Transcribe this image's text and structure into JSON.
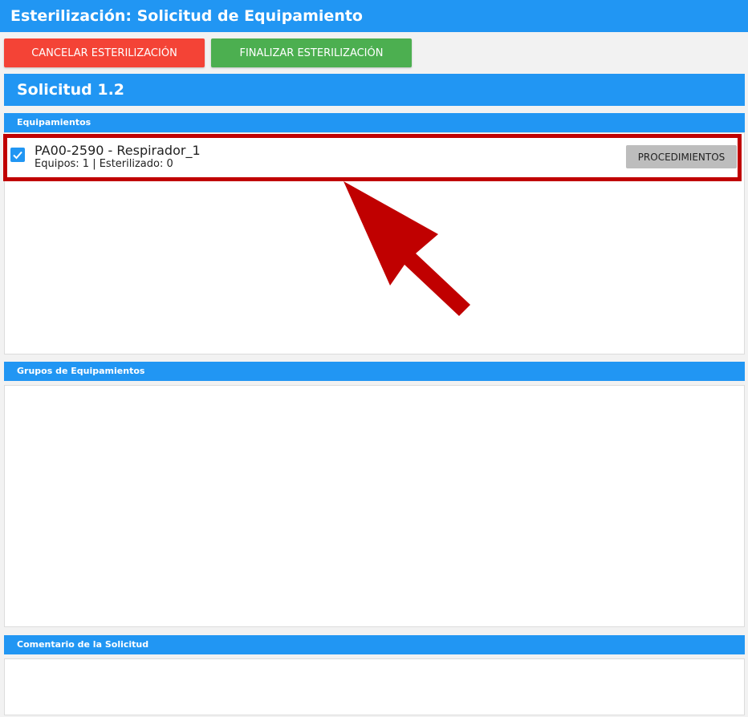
{
  "window": {
    "title": "Esterilización: Solicitud de Equipamiento"
  },
  "actions": {
    "cancel_label": "CANCELAR ESTERILIZACIÓN",
    "finish_label": "FINALIZAR ESTERILIZACIÓN"
  },
  "request": {
    "title": "Solicitud 1.2"
  },
  "sections": {
    "equipment": "Equipamientos",
    "groups": "Grupos de Equipamientos",
    "comment": "Comentario de la Solicitud"
  },
  "equipment_items": [
    {
      "title": "PA00-2590 - Respirador_1",
      "subtitle": "Equipos: 1 | Esterilizado: 0",
      "checked": true,
      "button_label": "PROCEDIMIENTOS"
    }
  ],
  "colors": {
    "primary": "#2196f3",
    "cancel": "#f44336",
    "finish": "#4caf50",
    "highlight": "#c00000"
  }
}
